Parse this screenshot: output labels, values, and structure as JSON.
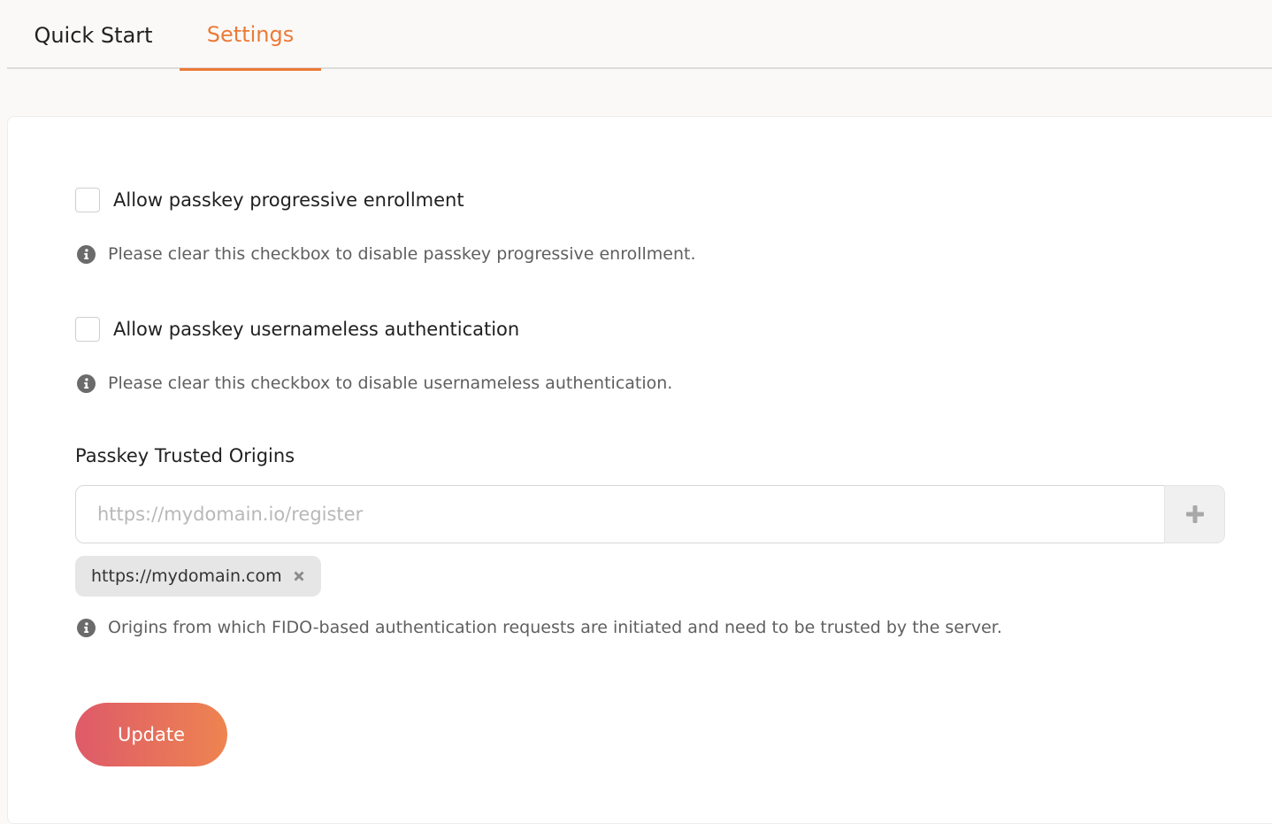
{
  "tabs": [
    {
      "label": "Quick Start",
      "active": false
    },
    {
      "label": "Settings",
      "active": true
    }
  ],
  "settings": {
    "progressive_enrollment": {
      "label": "Allow passkey progressive enrollment",
      "checked": false,
      "hint": "Please clear this checkbox to disable passkey progressive enrollment."
    },
    "usernameless_auth": {
      "label": "Allow passkey usernameless authentication",
      "checked": false,
      "hint": "Please clear this checkbox to disable usernameless authentication."
    },
    "trusted_origins": {
      "label": "Passkey Trusted Origins",
      "input_value": "",
      "placeholder": "https://mydomain.io/register",
      "origins": [
        "https://mydomain.com"
      ],
      "hint": "Origins from which FIDO-based authentication requests are initiated and need to be trusted by the server."
    },
    "update_label": "Update"
  },
  "icons": {
    "info": "info-icon",
    "add": "plus-icon",
    "remove": "close-x-icon"
  },
  "colors": {
    "accent": "#ec7a37",
    "button_gradient_start": "#de5a69",
    "button_gradient_end": "#ee8450"
  }
}
